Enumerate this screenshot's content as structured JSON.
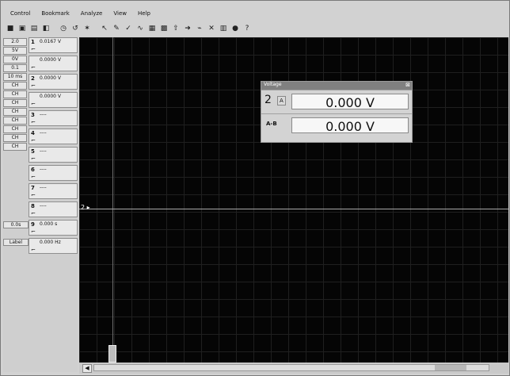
{
  "menu": [
    "Control",
    "Bookmark",
    "Analyze",
    "View",
    "Help"
  ],
  "toolbar_icons": [
    "save-icon",
    "open-icon",
    "print-icon",
    "copy-icon",
    "clock-icon",
    "undo-icon",
    "gear-icon",
    "cursor-icon",
    "marker-icon",
    "check-icon",
    "waveform-icon",
    "chart-icon",
    "grid-icon",
    "trigger-icon",
    "arrow-icon",
    "signal-icon",
    "cross-icon",
    "panel-icon",
    "record-icon",
    "help-icon"
  ],
  "left_panel": {
    "col1": [
      "2.0",
      "5V",
      "0V",
      "0.1",
      "10 ms",
      "CH",
      "CH",
      "CH",
      "CH",
      "CH",
      "CH",
      "CH",
      "CH"
    ],
    "channels": [
      {
        "num": "1",
        "value": "0.0167 V"
      },
      {
        "num": "",
        "value": "0.0000 V"
      },
      {
        "num": "2",
        "value": "0.0000 V"
      },
      {
        "num": "",
        "value": "0.0000 V"
      },
      {
        "num": "3",
        "value": "----"
      },
      {
        "num": "4",
        "value": "----"
      },
      {
        "num": "5",
        "value": "----"
      },
      {
        "num": "6",
        "value": "----"
      },
      {
        "num": "7",
        "value": "----"
      },
      {
        "num": "8",
        "value": "----"
      },
      {
        "num": "9",
        "value": "0.000 s"
      },
      {
        "num": "",
        "value": "0.000 Hz"
      }
    ],
    "extra": [
      "0.0s",
      "Label"
    ]
  },
  "scope": {
    "marker": "2 ▸"
  },
  "voltage_panel": {
    "title": "Voltage",
    "rows": [
      {
        "label": "2",
        "chip": "A",
        "value": "0.000 V"
      },
      {
        "label": "",
        "chip": "A-B",
        "value": "0.000 V"
      }
    ]
  }
}
